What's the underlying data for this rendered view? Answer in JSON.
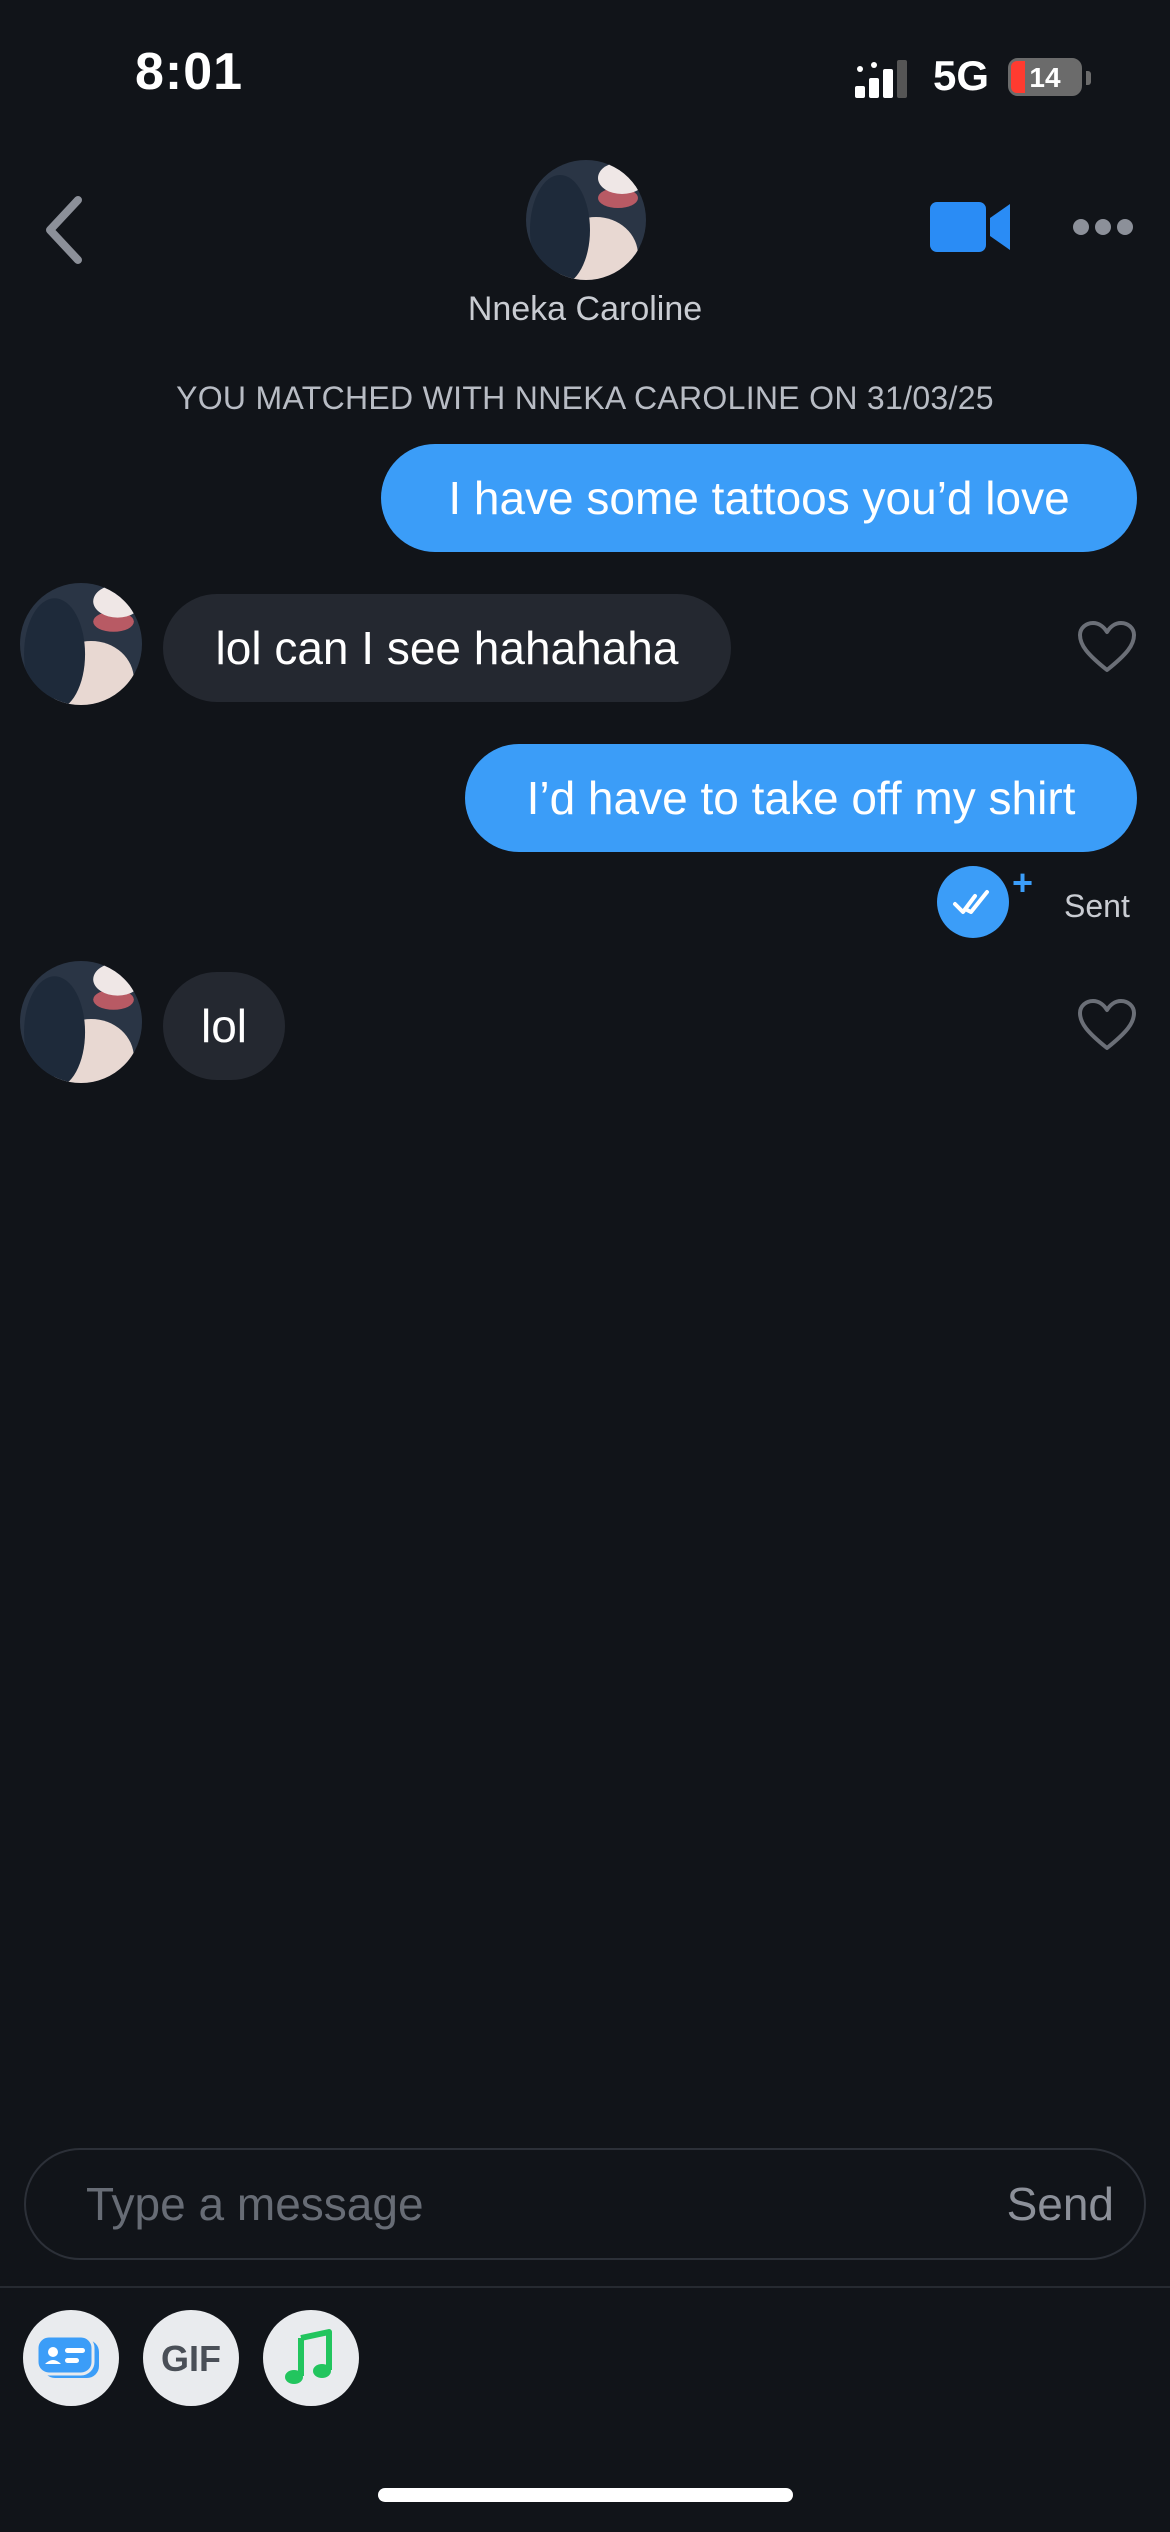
{
  "status_bar": {
    "time": "8:01",
    "network": "5G",
    "battery_level": "14"
  },
  "header": {
    "contact_name": "Nneka Caroline",
    "back_icon": "chevron-left-icon",
    "video_icon": "video-call-icon",
    "more_icon": "more-horizontal-icon"
  },
  "chat": {
    "match_note": "YOU MATCHED WITH NNEKA CAROLINE ON 31/03/25",
    "messages": [
      {
        "from": "me",
        "text": "I have some tattoos you’d love"
      },
      {
        "from": "them",
        "text": "lol can I see hahahaha"
      },
      {
        "from": "me",
        "text": "I’d have to take off my shirt"
      },
      {
        "from": "them",
        "text": "lol"
      }
    ],
    "receipt": {
      "status": "Sent",
      "plus": "+"
    }
  },
  "composer": {
    "placeholder": "Type a message",
    "send_label": "Send"
  },
  "toolbar": {
    "gif_label": "GIF",
    "tools": [
      "contact-card-icon",
      "gif-icon",
      "music-note-icon"
    ]
  },
  "colors": {
    "background": "#111419",
    "accent": "#3b9df8",
    "incoming_bubble": "#242830",
    "music_green": "#22c55e"
  }
}
